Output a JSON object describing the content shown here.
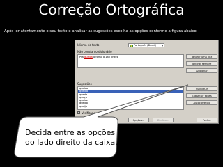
{
  "slide": {
    "title": "Correção Ortográfica",
    "instructions": "Após ler atentamente o seu texto e analisar as sugestões escolha as opções conforme a figura abaixo:",
    "callout": {
      "line1": "Decida entre as opções",
      "line2": "do lado direito da caixa."
    }
  },
  "dialog": {
    "language_label": "Idioma do texto",
    "language_value": "Português (Brasil)",
    "not_in_dictionary_label": "Não consta do dicionário",
    "text_before": "Pra ",
    "misspelled_word": "queiça",
    "text_after": " o forno a 180 graus",
    "suggestions_label": "Sugestões",
    "suggestions": [
      "queixa",
      "queixa",
      "queda",
      "queça",
      "queixe",
      "queixo",
      "queija"
    ],
    "selected_suggestion_index": 1,
    "buttons": {
      "ignore_once": "Ignorar uma vez",
      "ignore_all": "Ignorar sempre",
      "add": "Adicionar",
      "replace": "Substituir",
      "replace_all": "Substituir todas",
      "autocorrect": "Autocorreção"
    },
    "check_grammar_label": "Verificar gramática",
    "check_grammar_checked": true,
    "footer_buttons": {
      "options": "Opções...",
      "undo": "Desfazer",
      "close": "Fechar"
    }
  },
  "colors": {
    "background": "#000000",
    "title_text": "#ffffff",
    "selection": "#3a62b8",
    "misspelling": "#cc0000"
  }
}
